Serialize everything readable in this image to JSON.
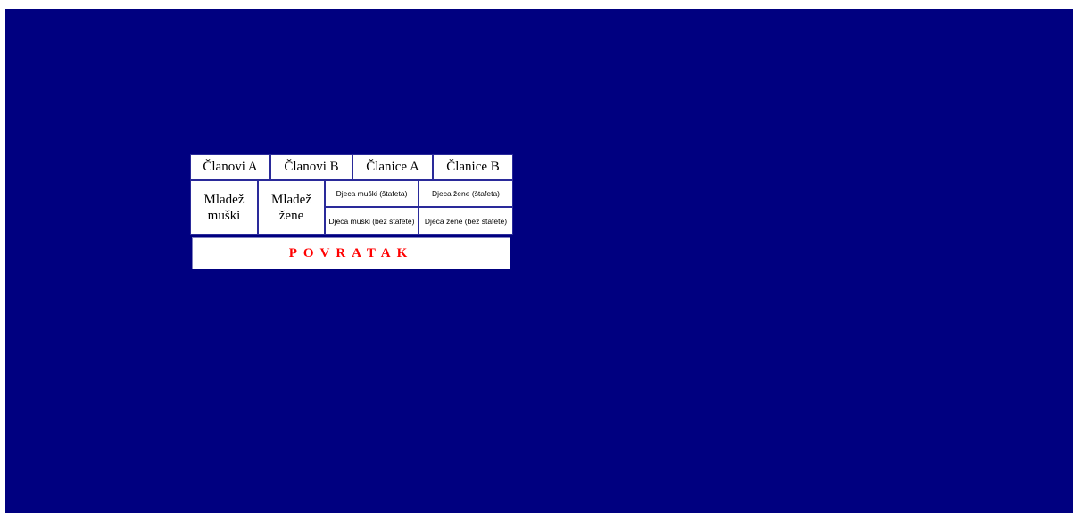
{
  "menu": {
    "row1": [
      "Članovi A",
      "Članovi B",
      "Članice A",
      "Članice B"
    ],
    "youth_male": "Mladež muški",
    "youth_female": "Mladež žene",
    "kids_male_relay": "Djeca muški (štafeta)",
    "kids_female_relay": "Djeca žene (štafeta)",
    "kids_male_no_relay": "Djeca muški (bez štafete)",
    "kids_female_no_relay": "Djeca žene (bez štafete)",
    "back_label": "POVRATAK"
  },
  "colors": {
    "background": "#000080",
    "button": "#ffffff",
    "back_text": "#ff0000"
  }
}
